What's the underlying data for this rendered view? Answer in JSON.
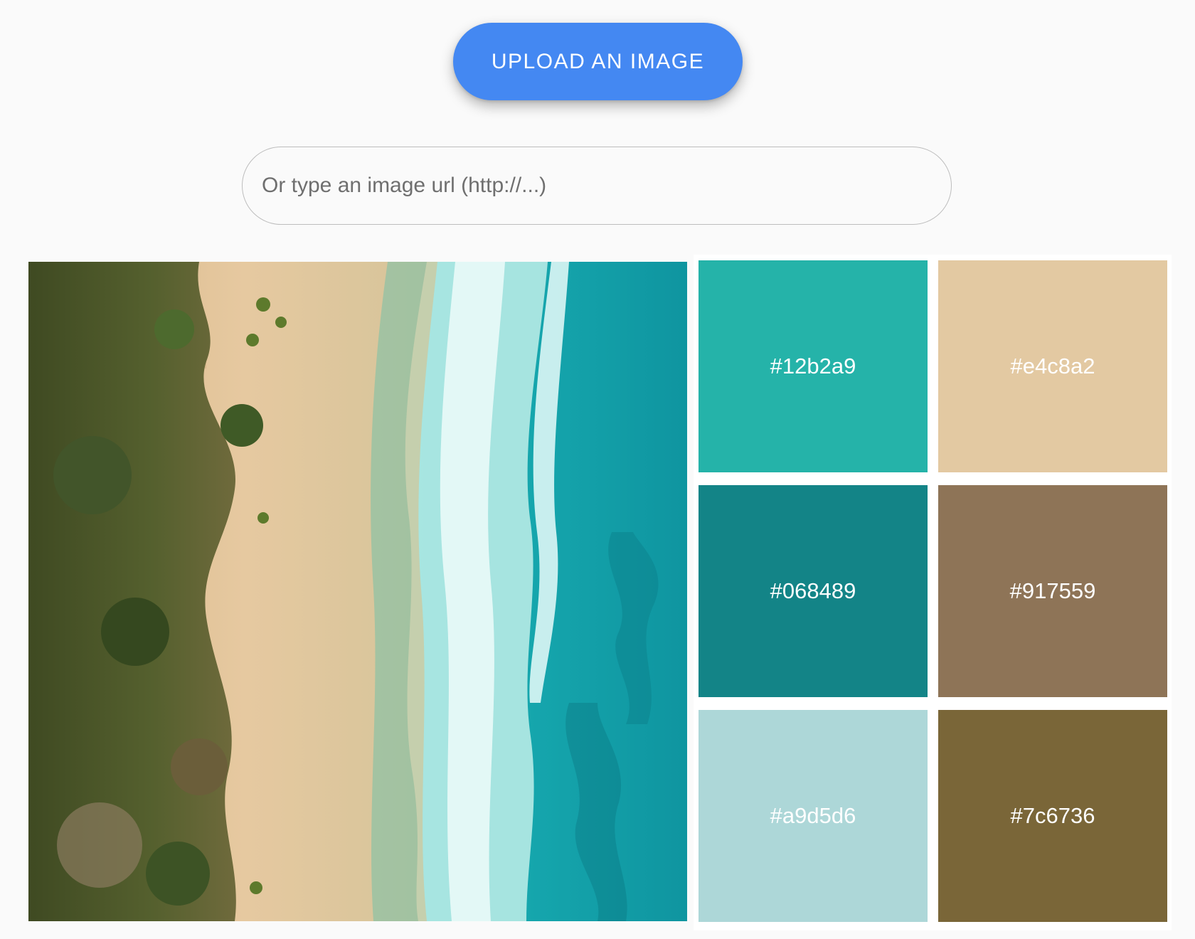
{
  "upload": {
    "label": "UPLOAD AN IMAGE"
  },
  "url_input": {
    "placeholder": "Or type an image url (http://...)",
    "value": ""
  },
  "image": {
    "subject": "aerial beach with turquoise sea, white surf, sand and palm trees"
  },
  "palette": {
    "swatches": [
      {
        "label": "#12b2a9",
        "color": "#25b3a9"
      },
      {
        "label": "#e4c8a2",
        "color": "#e3c9a2"
      },
      {
        "label": "#068489",
        "color": "#138487"
      },
      {
        "label": "#917559",
        "color": "#8e7457"
      },
      {
        "label": "#a9d5d6",
        "color": "#add7d8"
      },
      {
        "label": "#7c6736",
        "color": "#7a6638"
      }
    ]
  },
  "colors": {
    "accent": "#4488f2",
    "background": "#fafafa",
    "panel": "#ffffff"
  }
}
